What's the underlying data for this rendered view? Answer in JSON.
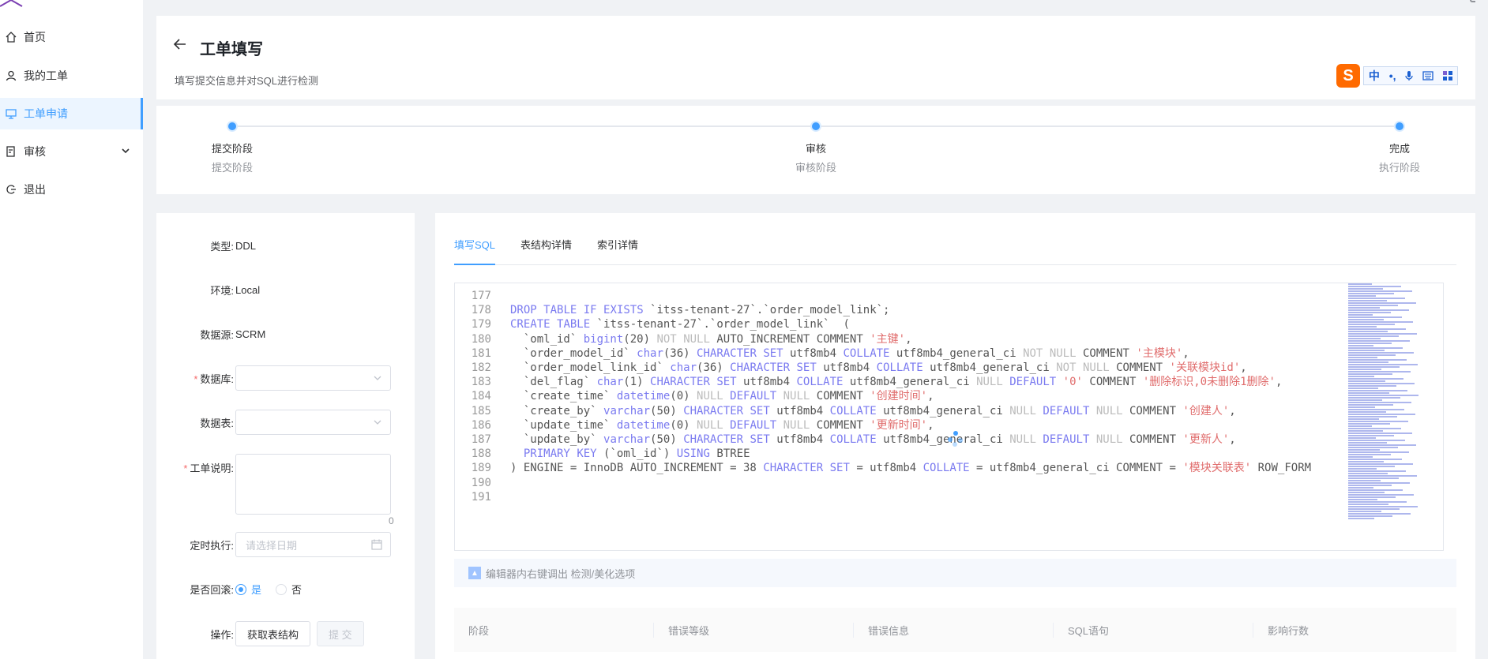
{
  "sidebar": {
    "items": [
      {
        "label": "首页",
        "icon": "home-icon"
      },
      {
        "label": "我的工单",
        "icon": "user-icon"
      },
      {
        "label": "工单申请",
        "icon": "monitor-icon",
        "active": true
      },
      {
        "label": "审核",
        "icon": "audit-icon",
        "expandable": true
      },
      {
        "label": "退出",
        "icon": "logout-icon"
      }
    ]
  },
  "header": {
    "title": "工单填写",
    "subtitle": "填写提交信息并对SQL进行检测"
  },
  "ime": {
    "logo": "S",
    "items": [
      "中",
      "•,",
      "mic",
      "kbd",
      "grid"
    ]
  },
  "steps": [
    {
      "title": "提交阶段",
      "desc": "提交阶段"
    },
    {
      "title": "审核",
      "desc": "审核阶段"
    },
    {
      "title": "完成",
      "desc": "执行阶段"
    }
  ],
  "form": {
    "type_label": "类型:",
    "type_value": "DDL",
    "env_label": "环境:",
    "env_value": "Local",
    "source_label": "数据源:",
    "source_value": "SCRM",
    "db_label": "数据库:",
    "table_label": "数据表:",
    "desc_label": "工单说明:",
    "desc_count": "0",
    "schedule_label": "定时执行:",
    "schedule_placeholder": "请选择日期",
    "rollback_label": "是否回滚:",
    "rollback_yes": "是",
    "rollback_no": "否",
    "ops_label": "操作:",
    "btn_fetch": "获取表结构",
    "btn_submit": "提 交"
  },
  "editor": {
    "tabs": [
      "填写SQL",
      "表结构详情",
      "索引详情"
    ],
    "active_tab": 0,
    "hint": "编辑器内右键调出 检测/美化选项"
  },
  "code_lines": [
    {
      "n": "177",
      "t": ""
    },
    {
      "n": "178",
      "t": "DROP TABLE IF EXISTS `itss-tenant-27`.`order_model_link`;"
    },
    {
      "n": "179",
      "t": "CREATE TABLE `itss-tenant-27`.`order_model_link`  ("
    },
    {
      "n": "180",
      "t": "  `oml_id` bigint(20) NOT NULL AUTO_INCREMENT COMMENT '主键',"
    },
    {
      "n": "181",
      "t": "  `order_model_id` char(36) CHARACTER SET utf8mb4 COLLATE utf8mb4_general_ci NOT NULL COMMENT '主模块',"
    },
    {
      "n": "182",
      "t": "  `order_model_link_id` char(36) CHARACTER SET utf8mb4 COLLATE utf8mb4_general_ci NOT NULL COMMENT '关联模块id',"
    },
    {
      "n": "183",
      "t": "  `del_flag` char(1) CHARACTER SET utf8mb4 COLLATE utf8mb4_general_ci NULL DEFAULT '0' COMMENT '删除标识,0未删除1删除',"
    },
    {
      "n": "184",
      "t": "  `create_time` datetime(0) NULL DEFAULT NULL COMMENT '创建时间',"
    },
    {
      "n": "185",
      "t": "  `create_by` varchar(50) CHARACTER SET utf8mb4 COLLATE utf8mb4_general_ci NULL DEFAULT NULL COMMENT '创建人',"
    },
    {
      "n": "186",
      "t": "  `update_time` datetime(0) NULL DEFAULT NULL COMMENT '更新时间',"
    },
    {
      "n": "187",
      "t": "  `update_by` varchar(50) CHARACTER SET utf8mb4 COLLATE utf8mb4_general_ci NULL DEFAULT NULL COMMENT '更新人',"
    },
    {
      "n": "188",
      "t": "  PRIMARY KEY (`oml_id`) USING BTREE"
    },
    {
      "n": "189",
      "t": ") ENGINE = InnoDB AUTO_INCREMENT = 38 CHARACTER SET = utf8mb4 COLLATE = utf8mb4_general_ci COMMENT = '模块关联表' ROW_FORM"
    },
    {
      "n": "190",
      "t": ""
    },
    {
      "n": "191",
      "t": ""
    }
  ],
  "result_table": {
    "headers": [
      "阶段",
      "错误等级",
      "错误信息",
      "SQL语句",
      "影响行数"
    ]
  },
  "colors": {
    "accent": "#409eff",
    "required": "#f56c6c",
    "keyword": "#7a7af0",
    "string": "#e06c6c"
  }
}
